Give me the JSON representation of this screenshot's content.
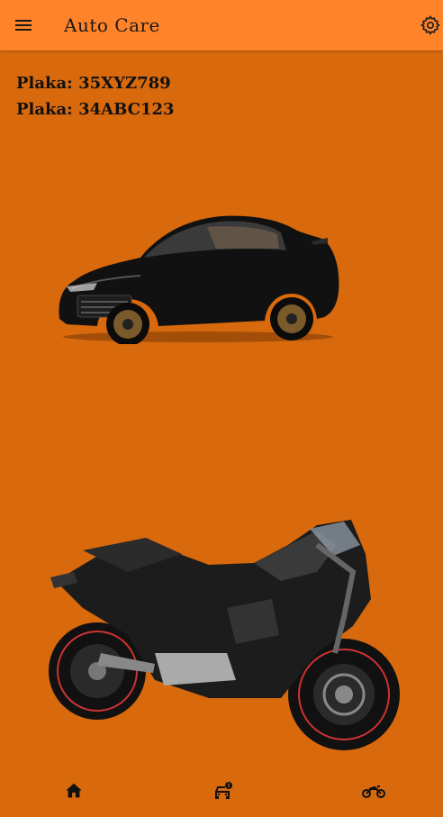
{
  "app_bar": {
    "title": "Auto Care",
    "menu_icon": "menu-icon",
    "settings_icon": "settings-icon",
    "background": "#FE8329"
  },
  "plates": [
    {
      "label": "Plaka: 35XYZ789"
    },
    {
      "label": "Plaka: 34ABC123"
    }
  ],
  "vehicles": [
    {
      "type": "car",
      "color": "black"
    },
    {
      "type": "motorcycle",
      "color": "black"
    }
  ],
  "bottom_nav": {
    "items": [
      {
        "icon": "home-icon"
      },
      {
        "icon": "car-service-icon"
      },
      {
        "icon": "motorcycle-icon"
      }
    ]
  },
  "colors": {
    "body_background": "#D8690D",
    "app_bar": "#FE8329"
  }
}
